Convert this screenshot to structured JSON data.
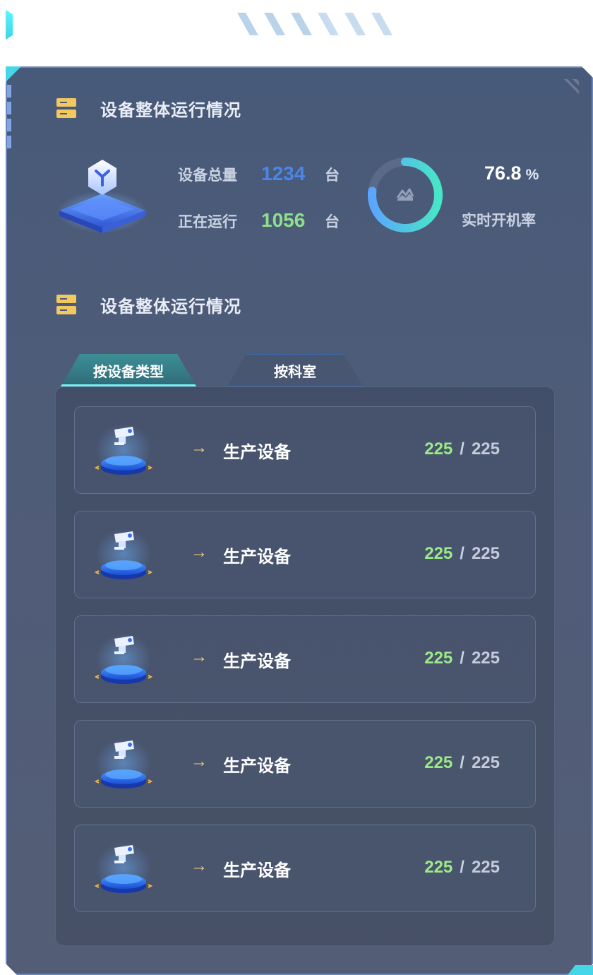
{
  "colors": {
    "accent_cyan": "#47d6e8",
    "total_blue": "#4a86e8",
    "running_green": "#8ee08a",
    "section_icon_yellow": "#f3c95f",
    "panel_bg": "#4d5b77"
  },
  "section1": {
    "title": "设备整体运行情况"
  },
  "overview": {
    "total_label": "设备总量",
    "total_value": "1234",
    "total_unit": "台",
    "running_label": "正在运行",
    "running_value": "1056",
    "running_unit": "台",
    "rate_value": "76.8",
    "rate_unit": "%",
    "rate_label": "实时开机率",
    "rate_fraction": 0.768
  },
  "section2": {
    "title": "设备整体运行情况"
  },
  "tabs": [
    {
      "label": "按设备类型",
      "active": true
    },
    {
      "label": "按科室",
      "active": false
    }
  ],
  "devices": [
    {
      "name": "生产设备",
      "running": "225",
      "total": "225",
      "icon": "camera-icon"
    },
    {
      "name": "生产设备",
      "running": "225",
      "total": "225",
      "icon": "camera-icon"
    },
    {
      "name": "生产设备",
      "running": "225",
      "total": "225",
      "icon": "camera-icon"
    },
    {
      "name": "生产设备",
      "running": "225",
      "total": "225",
      "icon": "camera-icon"
    },
    {
      "name": "生产设备",
      "running": "225",
      "total": "225",
      "icon": "camera-icon"
    }
  ],
  "arrow_glyph": "→",
  "separator": "/"
}
